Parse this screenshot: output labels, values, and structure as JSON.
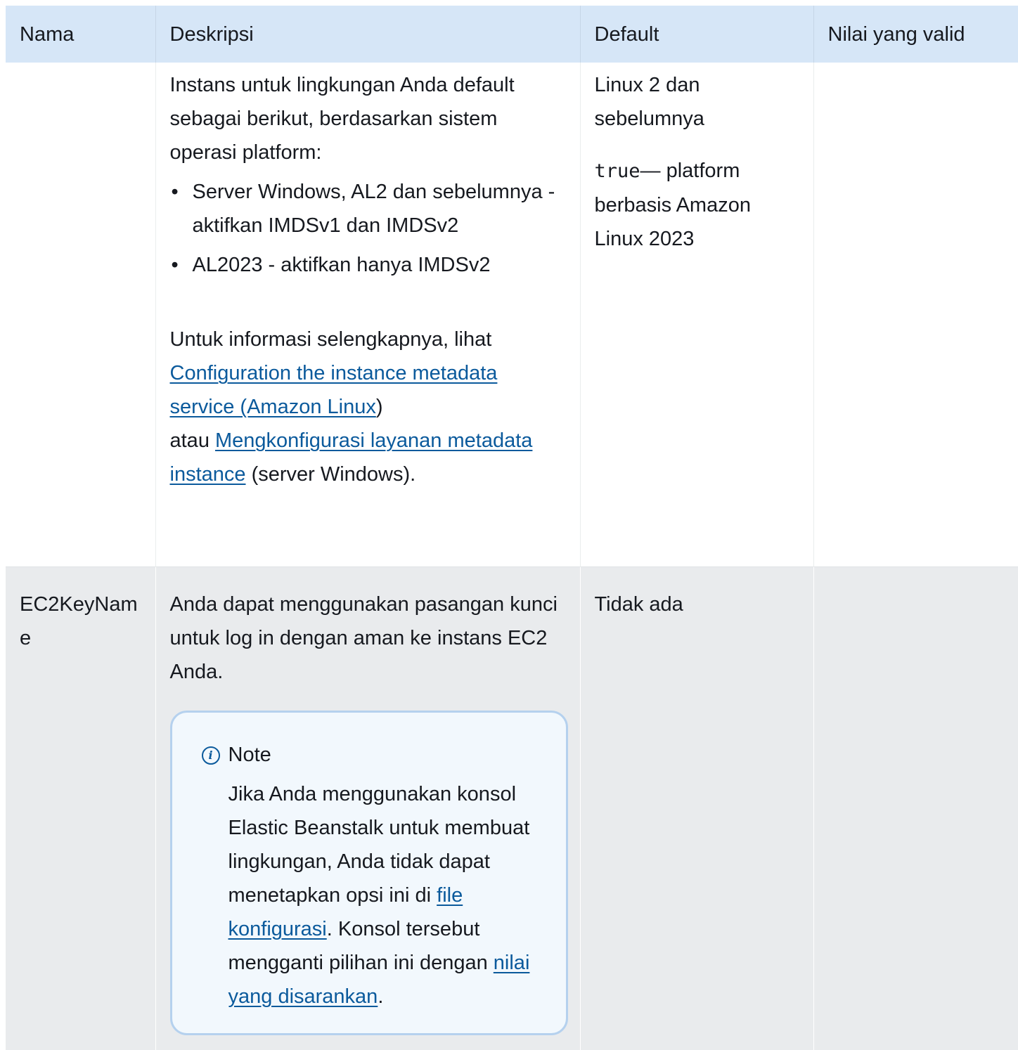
{
  "header": {
    "col_name": "Nama",
    "col_desc": "Deskripsi",
    "col_default": "Default",
    "col_valid": "Nilai yang valid"
  },
  "row1": {
    "name": "",
    "desc_intro": "Instans untuk lingkungan Anda default sebagai berikut, berdasarkan sistem operasi platform:",
    "bullets": [
      "Server Windows, AL2 dan sebelumnya - aktifkan IMDSv1 dan IMDSv2",
      "AL2023 - aktifkan hanya IMDSv2"
    ],
    "more_prefix": "Untuk informasi selengkapnya, lihat ",
    "link1": "Configuration the instance metadata service (Amazon Linux",
    "link1_suffix": ")",
    "or_text": "atau ",
    "link2": "Mengkonfigurasi layanan metadata instance",
    "link2_suffix": " (server Windows).",
    "default_line1": "Linux 2 dan sebelumnya",
    "default_code": "true",
    "default_line2": "— platform berbasis Amazon Linux 2023",
    "valid": ""
  },
  "row2": {
    "name": "EC2KeyName",
    "desc": "Anda dapat menggunakan pasangan kunci untuk log in dengan aman ke instans EC2 Anda.",
    "note_icon": "info-icon",
    "note_title": "Note",
    "note_text_1": "Jika Anda menggunakan konsol Elastic Beanstalk untuk membuat lingkungan, Anda tidak dapat menetapkan opsi ini di ",
    "note_link_1": "file konfigurasi",
    "note_text_2": ". Konsol tersebut mengganti pilihan ini dengan ",
    "note_link_2": "nilai yang disarankan",
    "note_text_3": ".",
    "default": "Tidak ada",
    "valid": ""
  },
  "colors": {
    "header_bg": "#d6e6f7",
    "row_alt_bg": "#e9ebed",
    "link": "#0b5a9c",
    "note_border": "#b5d1ee",
    "note_bg": "#f2f8fd"
  }
}
